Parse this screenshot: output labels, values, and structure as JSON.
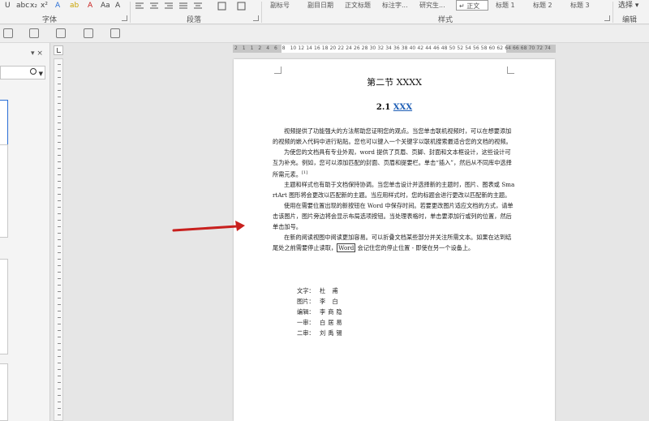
{
  "ribbon": {
    "format_buttons": [
      "U",
      "abc",
      "x₂",
      "x²"
    ],
    "color_buttons": [
      "A",
      "ab",
      "A",
      "Aa",
      "A"
    ],
    "groups": {
      "font": "字体",
      "paragraph": "段落",
      "styles": "样式",
      "editing": "编辑"
    },
    "styles": [
      "副标号",
      "副目日期",
      "正文标题",
      "标注字...",
      "研究生...",
      "↵ 正文",
      "标题 1",
      "标题 2",
      "标题 3"
    ],
    "select_label": "选择 ▾"
  },
  "nav": {
    "collapse": "▾ ×"
  },
  "ruler": {
    "numbers": [
      "2",
      "1",
      "1",
      "2",
      "4",
      "6",
      "8",
      "10",
      "12",
      "14",
      "16",
      "18",
      "20",
      "22",
      "24",
      "26",
      "28",
      "30",
      "32",
      "34",
      "36",
      "38",
      "40",
      "42",
      "44",
      "46",
      "48",
      "50",
      "52",
      "54",
      "56",
      "58",
      "60",
      "62",
      "64",
      "66",
      "68",
      "70",
      "72",
      "74"
    ]
  },
  "doc": {
    "heading1": "第二节  XXXX",
    "heading2_num": "2.1 ",
    "heading2_link": "XXX",
    "paragraphs": {
      "p1": "视频提供了功能强大的方法帮助您证明您的观点。当您单击联机视频时，可以在想要添加的视频的嵌入代码中进行粘贴。您也可以键入一个关键字以联机搜索最适合您的文档的视频。",
      "p2": "为使您的文档具有专业外观，word 提供了页眉、页脚、封面和文本框设计，这些设计可互为补充。例如，您可以添加匹配的封面、页眉和提要栏。单击“插入”，然后从不同库中选择所需元素。",
      "p2_sup": "[1]",
      "p3": "主题和样式也有助于文档保持协调。当您单击设计并选择新的主题时，图片、图表或 SmartArt 图形将会更改以匹配新的主题。当应用样式时，您的标题会进行更改以匹配新的主题。",
      "p4": "使用在需要位置出现的新按钮在 Word 中保存时间。若要更改图片适应文档的方式，请单击该图片，图片旁边将会显示布局选项按钮。当处理表格时，单击要添加行或列的位置，然后单击加号。",
      "p5_a": "在新的阅读视图中阅读更加容易。可以折叠文档某些部分并关注所需文本。如果在达到结尾处之前需要停止读取，",
      "p5_box": "Word",
      "p5_b": " 会记住您的停止位置 - 即使在另一个设备上。"
    },
    "credits": [
      {
        "label": "文字：",
        "name": "杜  甫"
      },
      {
        "label": "图片：",
        "name": "李  白"
      },
      {
        "label": "编辑：",
        "name": "李商隐"
      },
      {
        "label": "一审：",
        "name": "白居易"
      },
      {
        "label": "二审：",
        "name": "刘禹锡"
      }
    ]
  },
  "colors": {
    "arrow": "#c8201e",
    "link": "#1f5fb6",
    "page_bg": "#ffffff",
    "app_bg": "#e6e6e6"
  }
}
